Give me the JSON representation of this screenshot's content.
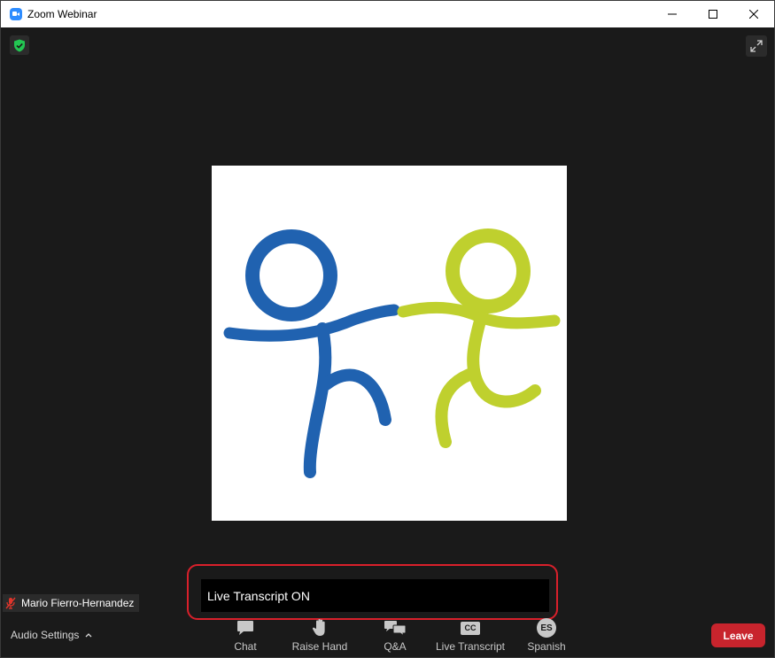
{
  "window": {
    "title": "Zoom Webinar",
    "accent": "#2d8cff"
  },
  "video": {
    "presenter_name": "Mario Fierro-Hernandez",
    "logo_colors": {
      "blue": "#2062b0",
      "green": "#bfd02e"
    }
  },
  "caption": {
    "text": "Live Transcript ON",
    "highlight_color": "#d9202b"
  },
  "toolbar": {
    "audio_settings_label": "Audio Settings",
    "items": [
      {
        "label": "Chat",
        "icon": "chat-icon"
      },
      {
        "label": "Raise Hand",
        "icon": "hand-icon"
      },
      {
        "label": "Q&A",
        "icon": "qa-icon"
      },
      {
        "label": "Live Transcript",
        "icon": "cc-icon",
        "badge": "CC"
      },
      {
        "label": "Spanish",
        "icon": "language-icon",
        "badge": "ES"
      }
    ],
    "leave_label": "Leave",
    "leave_color": "#c8242d"
  }
}
